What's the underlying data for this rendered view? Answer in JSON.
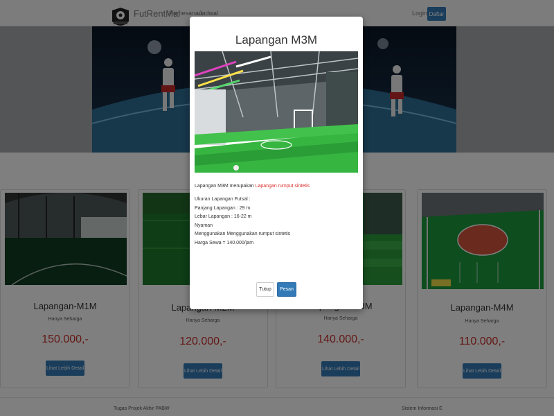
{
  "navbar": {
    "brand": "FutRentMal",
    "links": [
      "Pemesanan",
      "Jadwal"
    ],
    "login": "Login",
    "daftar": "Daftar"
  },
  "cards": [
    {
      "title": "Lapangan-M1M",
      "subtitle": "Hanya Seharga",
      "price": "150.000,-",
      "button": "Lihat Lebih Detail",
      "field_color": "dark-green"
    },
    {
      "title": "Lapangan-M2M",
      "subtitle": "Hanya Seharga",
      "price": "120.000,-",
      "button": "Lihat Lebih Detail",
      "field_color": "green"
    },
    {
      "title": "Lapangan-M3M",
      "subtitle": "Hanya Seharga",
      "price": "140.000,-",
      "button": "Lihat Lebih Detail",
      "field_color": "green"
    },
    {
      "title": "Lapangan-M4M",
      "subtitle": "Hanya Seharga",
      "price": "110.000,-",
      "button": "Lihat Lebih Detail",
      "field_color": "green-orange"
    }
  ],
  "footer": {
    "left": "Tugas Projek Akhir PABW",
    "right": "Sistem Informasi E"
  },
  "modal": {
    "title": "Lapangan M3M",
    "intro_text": "Lapangan M3M merupakan ",
    "intro_link": "Lapangan rumput sintetis",
    "details": [
      "Ukuran Lapangan Futsal :",
      "Panjang Lapangan : 29 m",
      "Lebar Lapangan : 16-22 m",
      "Nyaman",
      "Menggunakan Menggunakan rumput sintetis",
      "Harga Sewa = 140.000/jam"
    ],
    "close_button": "Tutup",
    "order_button": "Pesan"
  },
  "colors": {
    "primary": "#337ab7",
    "price": "#c9302c",
    "link": "#d9302c",
    "overlay": "rgba(0,0,0,0.5)"
  }
}
